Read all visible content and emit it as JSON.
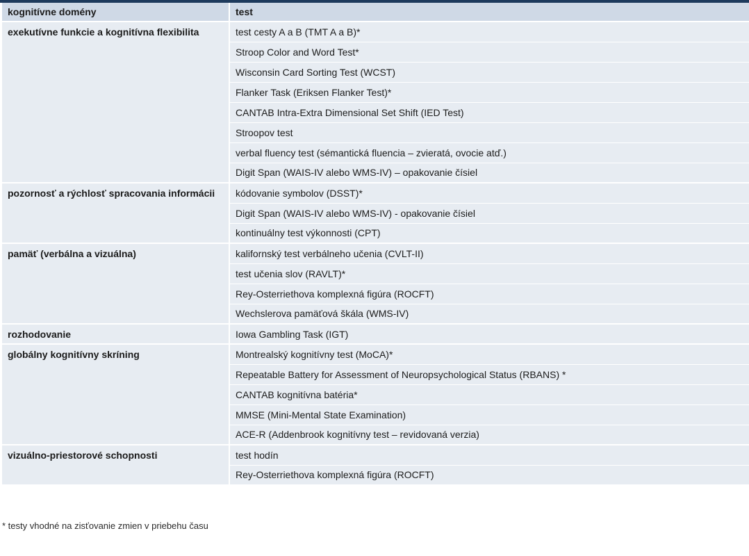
{
  "table": {
    "headers": {
      "domain": "kognitívne domény",
      "test": "test"
    },
    "groups": [
      {
        "domain": "exekutívne funkcie a kognitívna flexibilita",
        "tests": [
          "test cesty A a B (TMT A a B)*",
          "Stroop Color and Word Test*",
          "Wisconsin Card Sorting Test (WCST)",
          "Flanker Task (Eriksen Flanker Test)*",
          "CANTAB Intra-Extra Dimensional Set Shift (IED Test)",
          "Stroopov test",
          "verbal fluency test (sémantická fluencia – zvieratá, ovocie atď.)",
          "Digit Span (WAIS-IV alebo WMS-IV) – opakovanie čísiel"
        ]
      },
      {
        "domain": "pozornosť a rýchlosť spracovania informácii",
        "tests": [
          "kódovanie symbolov (DSST)*",
          "Digit Span (WAIS-IV alebo WMS-IV) - opakovanie čísiel",
          "kontinuálny test výkonnosti (CPT)"
        ]
      },
      {
        "domain": "pamäť (verbálna a vizuálna)",
        "tests": [
          "kalifornský test verbálneho učenia (CVLT-II)",
          "test učenia slov (RAVLT)*",
          "Rey-Osterriethova komplexná figúra (ROCFT)",
          "Wechslerova pamäťová škála (WMS-IV)"
        ]
      },
      {
        "domain": "rozhodovanie",
        "tests": [
          "Iowa Gambling Task (IGT)"
        ]
      },
      {
        "domain": "globálny kognitívny skríning",
        "tests": [
          "Montrealský kognitívny test (MoCA)*",
          "Repeatable Battery for Assessment of Neuropsychological Status (RBANS) *",
          "CANTAB kognitívna batéria*",
          "MMSE (Mini-Mental State Examination)",
          "ACE-R (Addenbrook kognitívny test – revidovaná verzia)"
        ]
      },
      {
        "domain": "vizuálno-priestorové schopnosti",
        "tests": [
          "test hodín",
          "Rey-Osterriethova komplexná figúra (ROCFT)"
        ]
      }
    ]
  },
  "footnote": "* testy vhodné na zisťovanie zmien v priebehu času",
  "colors": {
    "header_bg": "#cfd9e6",
    "cell_bg": "#e7ecf2",
    "top_rule": "#1d3a5c"
  }
}
